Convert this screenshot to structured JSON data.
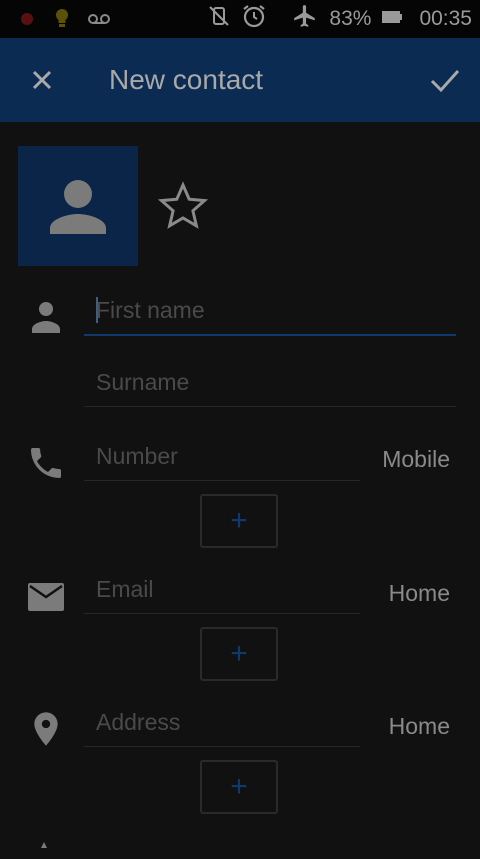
{
  "status_bar": {
    "icons": [
      "recording-dot-icon",
      "lightbulb-icon",
      "voicemail-icon",
      "vibrate-off-icon",
      "alarm-icon",
      "airplane-icon",
      "battery-icon"
    ],
    "battery": "83%",
    "time": "00:35"
  },
  "app_bar": {
    "title": "New contact",
    "close_icon": "close-icon",
    "save_icon": "check-icon"
  },
  "photo": {
    "icon": "person-avatar-icon"
  },
  "favorite": {
    "icon": "star-outline-icon"
  },
  "fields": {
    "first_name": {
      "placeholder": "First name",
      "value": ""
    },
    "surname": {
      "placeholder": "Surname",
      "value": ""
    },
    "number": {
      "placeholder": "Number",
      "value": "",
      "type": "Mobile"
    },
    "email": {
      "placeholder": "Email",
      "value": "",
      "type": "Home"
    },
    "address": {
      "placeholder": "Address",
      "value": "",
      "type": "Home"
    }
  },
  "add_button_symbol": "+",
  "colors": {
    "accent": "#1565c0",
    "appbar": "#0b2b52",
    "background": "#111111"
  }
}
